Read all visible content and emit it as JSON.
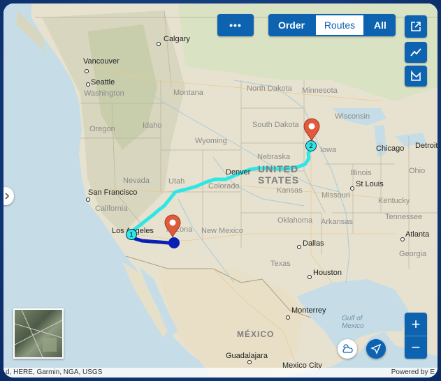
{
  "toolbar": {
    "more_label": "•••",
    "order_label": "Order",
    "routes_label": "Routes",
    "all_label": "All"
  },
  "side_buttons": {
    "export_icon": "external-link-icon",
    "chart_icon": "trend-line-icon",
    "area_icon": "area-chart-icon"
  },
  "zoom": {
    "in_label": "+",
    "out_label": "−"
  },
  "cities": [
    {
      "name": "Calgary"
    },
    {
      "name": "Vancouver"
    },
    {
      "name": "Seattle"
    },
    {
      "name": "San Francisco"
    },
    {
      "name": "Los Angeles"
    },
    {
      "name": "Denver"
    },
    {
      "name": "Dallas"
    },
    {
      "name": "Houston"
    },
    {
      "name": "St Louis"
    },
    {
      "name": "Chicago"
    },
    {
      "name": "Detroit"
    },
    {
      "name": "Atlanta"
    },
    {
      "name": "Monterrey"
    },
    {
      "name": "Guadalajara"
    },
    {
      "name": "Mexico City"
    }
  ],
  "regions": [
    "Washington",
    "Oregon",
    "Idaho",
    "Montana",
    "Wyoming",
    "Nevada",
    "California",
    "Utah",
    "Colorado",
    "Arizona",
    "New Mexico",
    "North Dakota",
    "South Dakota",
    "Nebraska",
    "Kansas",
    "Oklahoma",
    "Texas",
    "Minnesota",
    "Wisconsin",
    "Iowa",
    "Illinois",
    "Missouri",
    "Arkansas",
    "Ohio",
    "Kentucky",
    "Tennessee",
    "Georgia"
  ],
  "country_us_line1": "UNITED",
  "country_us_line2": "STATES",
  "country_mx": "MÉXICO",
  "gulf_line1": "Gulf of",
  "gulf_line2": "Mexico",
  "stops": [
    {
      "label": "1"
    },
    {
      "label": "2"
    }
  ],
  "attribution_left": "d, HERE, Garmin, NGA, USGS",
  "attribution_right": "Powered by E",
  "colors": {
    "route_primary": "#2ee6e6",
    "route_secondary": "#0a1fb5",
    "button": "#0d63b0",
    "pin": "#e05a3c"
  }
}
